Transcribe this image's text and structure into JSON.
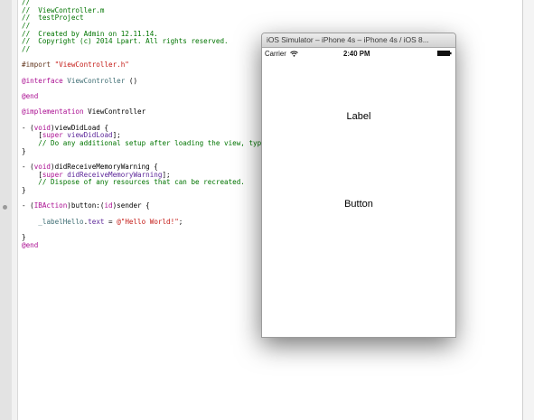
{
  "editor": {
    "lines": [
      {
        "segments": [
          {
            "t": "//",
            "c": "comment"
          }
        ]
      },
      {
        "segments": [
          {
            "t": "//  ViewController.m",
            "c": "comment"
          }
        ]
      },
      {
        "segments": [
          {
            "t": "//  testProject",
            "c": "comment"
          }
        ]
      },
      {
        "segments": [
          {
            "t": "//",
            "c": "comment"
          }
        ]
      },
      {
        "segments": [
          {
            "t": "//  Created by Admin on 12.11.14.",
            "c": "comment"
          }
        ]
      },
      {
        "segments": [
          {
            "t": "//  Copyright (c) 2014 Lpart. All rights reserved.",
            "c": "comment"
          }
        ]
      },
      {
        "segments": [
          {
            "t": "//",
            "c": "comment"
          }
        ]
      },
      {
        "segments": []
      },
      {
        "segments": [
          {
            "t": "#import ",
            "c": "pre"
          },
          {
            "t": "\"ViewController.h\"",
            "c": "str"
          }
        ]
      },
      {
        "segments": []
      },
      {
        "segments": [
          {
            "t": "@interface",
            "c": "kw"
          },
          {
            "t": " "
          },
          {
            "t": "ViewController",
            "c": "cls"
          },
          {
            "t": " ()"
          }
        ]
      },
      {
        "segments": []
      },
      {
        "segments": [
          {
            "t": "@end",
            "c": "kw"
          }
        ]
      },
      {
        "segments": []
      },
      {
        "segments": [
          {
            "t": "@implementation",
            "c": "kw"
          },
          {
            "t": " ViewController"
          }
        ]
      },
      {
        "segments": []
      },
      {
        "segments": [
          {
            "t": "- ("
          },
          {
            "t": "void",
            "c": "kw"
          },
          {
            "t": ")viewDidLoad {"
          }
        ]
      },
      {
        "segments": [
          {
            "t": "    ["
          },
          {
            "t": "super",
            "c": "kw"
          },
          {
            "t": " "
          },
          {
            "t": "viewDidLoad",
            "c": "prop"
          },
          {
            "t": "];"
          }
        ]
      },
      {
        "segments": [
          {
            "t": "    // Do any additional setup after loading the view, typic",
            "c": "comment"
          }
        ]
      },
      {
        "segments": [
          {
            "t": "}"
          }
        ]
      },
      {
        "segments": []
      },
      {
        "segments": [
          {
            "t": "- ("
          },
          {
            "t": "void",
            "c": "kw"
          },
          {
            "t": ")didReceiveMemoryWarning {"
          }
        ]
      },
      {
        "segments": [
          {
            "t": "    ["
          },
          {
            "t": "super",
            "c": "kw"
          },
          {
            "t": " "
          },
          {
            "t": "didReceiveMemoryWarning",
            "c": "prop"
          },
          {
            "t": "];"
          }
        ]
      },
      {
        "segments": [
          {
            "t": "    // Dispose of any resources that can be recreated.",
            "c": "comment"
          }
        ]
      },
      {
        "segments": [
          {
            "t": "}"
          }
        ]
      },
      {
        "segments": []
      },
      {
        "segments": [
          {
            "t": "- ("
          },
          {
            "t": "IBAction",
            "c": "kw"
          },
          {
            "t": ")button:("
          },
          {
            "t": "id",
            "c": "kw"
          },
          {
            "t": ")sender {"
          }
        ]
      },
      {
        "segments": []
      },
      {
        "segments": [
          {
            "t": "    "
          },
          {
            "t": "_labelHello",
            "c": "cls"
          },
          {
            "t": "."
          },
          {
            "t": "text",
            "c": "prop"
          },
          {
            "t": " = "
          },
          {
            "t": "@\"Hello World!\"",
            "c": "str"
          },
          {
            "t": ";"
          }
        ]
      },
      {
        "segments": []
      },
      {
        "segments": [
          {
            "t": "}"
          }
        ]
      },
      {
        "segments": [
          {
            "t": "@end",
            "c": "kw"
          }
        ]
      }
    ]
  },
  "simulator": {
    "title": "iOS Simulator – iPhone 4s – iPhone 4s / iOS 8...",
    "carrier": "Carrier",
    "time": "2:40 PM",
    "label_text": "Label",
    "button_text": "Button"
  },
  "colors": {
    "comment": "#007400",
    "keyword": "#aa0d91",
    "string": "#c41a16",
    "preprocessor": "#643820",
    "class": "#3f6e74",
    "property": "#5c2699"
  }
}
